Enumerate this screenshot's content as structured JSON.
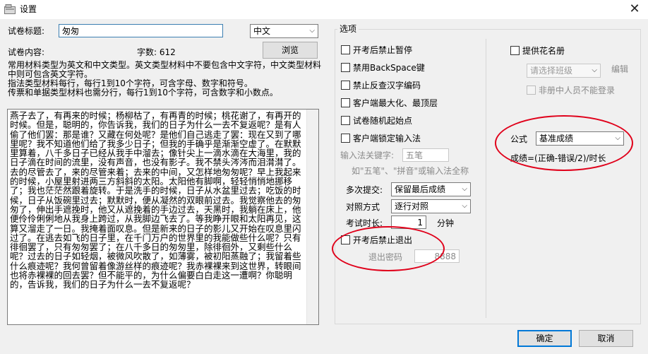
{
  "window": {
    "title": "设置",
    "close": "✕"
  },
  "paper_title": {
    "label": "试卷标题:",
    "value": "匆匆",
    "language": "中文"
  },
  "content": {
    "label": "试卷内容:",
    "char_count": "字数: 612",
    "browse": "浏览",
    "description": "常用材料类型为英文和中文类型。英文类型材料中不要包含中文字符，中文类型材料中则可包含英文字符。\n指法类型材料每行，每行1到10个字符，可含字母、数字和符号。\n传票和单据类型材料也需分行，每行1到10个字符，可含数字和小数点。",
    "text": "燕子去了，有再来的时候；杨柳枯了，有再青的时候；桃花谢了，有再开的时候。但是，聪明的，你告诉我，我们的日子为什么一去不复返呢？是有人偷了他们罢：那是谁？又藏在何处呢？是他们自己逃走了罢：现在又到了哪里呢？我不知道他们给了我多少日子；但我的手确乎是渐渐空虚了。在默默里算着，八千多日子已经从我手中溜去；像针尖上一滴水滴在大海里，我的日子滴在时间的流里，没有声音，也没有影子。我不禁头涔涔而泪潸潸了。去的尽管去了，来的尽管来着；去来的中间，又怎样地匆匆呢？早上我起来的时候，小屋里射进两三方斜斜的太阳。太阳他有脚啊，轻轻悄悄地挪移了；我也茫茫然跟着旋转。于是洗手的时候，日子从水盆里过去；吃饭的时候，日子从饭碗里过去；默默时，便从凝然的双眼前过去。我觉察他去的匆匆了，伸出手遮挽时，他又从遮挽着的手边过去，天黑时，我躺在床上，他便伶伶俐俐地从我身上跨过，从我脚边飞去了。等我睁开眼和太阳再见，这算又溜走了一日。我掩着面叹息。但是新来的日子的影儿又开始在叹息里闪过了。在逃去如飞的日子里，在千门万户的世界里的我能做些什么呢？只有徘徊罢了，只有匆匆罢了；在八千多日的匆匆里，除徘徊外，又剩些什么呢？过去的日子如轻烟，被微风吹散了，如薄雾，被初阳蒸融了；我留着些什么痕迹呢？我何曾留着像游丝样的痕迹呢？我赤裸裸来到这世界，转眼间也将赤裸裸的回去罢？但不能平的，为什么偏要白白走这一遭啊？你聪明的，告诉我，我们的日子为什么一去不复返呢？"
  },
  "options": {
    "group_title": "选项",
    "checks": [
      {
        "label": "开考后禁止暂停",
        "checked": false
      },
      {
        "label": "禁用BackSpace键",
        "checked": false
      },
      {
        "label": "禁止反查汉字编码",
        "checked": false
      },
      {
        "label": "客户端最大化、最顶层",
        "checked": false
      },
      {
        "label": "试卷随机起始点",
        "checked": false
      },
      {
        "label": "客户端锁定输入法",
        "checked": false
      }
    ],
    "ime_keyword": {
      "label": "输入法关键字:",
      "value": "五笔"
    },
    "ime_hint": "如\"五笔\"、\"拼音\"或输入法全称",
    "multi_submit": {
      "label": "多次提交:",
      "value": "保留最后成绩"
    },
    "compare": {
      "label": "对照方式",
      "value": "逐行对照"
    },
    "duration": {
      "label": "考试时长:",
      "value": "1",
      "unit": "分钟"
    },
    "no_exit": {
      "label": "开考后禁止退出",
      "checked": false
    },
    "exit_password": {
      "label": "退出密码",
      "value": "8888"
    },
    "roster": {
      "label": "提供花名册",
      "checked": false
    },
    "class_select": {
      "placeholder": "请选择班级"
    },
    "edit": "编辑",
    "non_roster": {
      "label": "非册中人员不能登录",
      "checked": false
    },
    "formula": {
      "label": "公式",
      "value": "基准成绩",
      "expression": "成绩=(正确-错误/2)/时长"
    }
  },
  "buttons": {
    "ok": "确定",
    "cancel": "取消"
  },
  "colors": {
    "annotation": "#e0001a",
    "focus_border": "#3c7fb1"
  },
  "icons": {
    "app": "settings-window-icon",
    "dropdown": "chevron-down-icon",
    "close": "close-icon"
  }
}
